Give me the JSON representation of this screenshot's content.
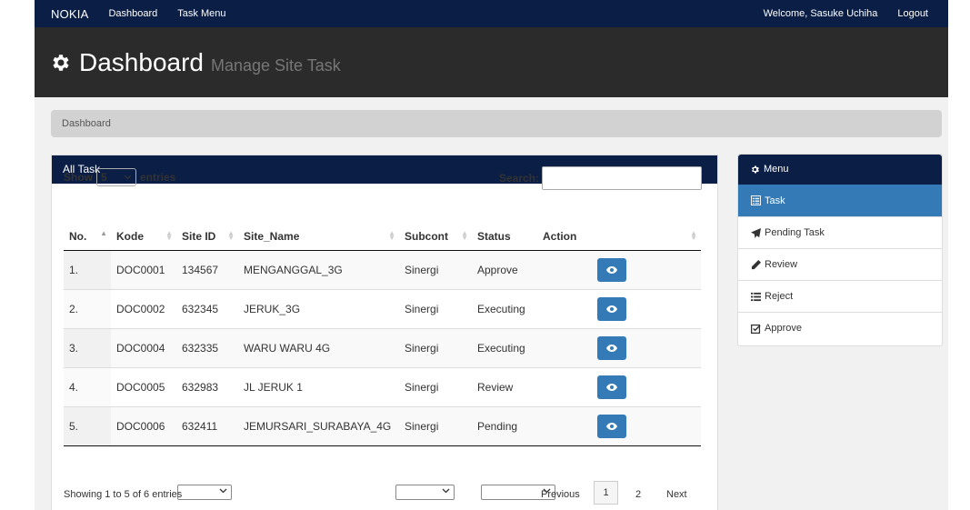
{
  "topbar": {
    "brand": "NOKIA",
    "nav": [
      "Dashboard",
      "Task Menu"
    ],
    "welcome": "Welcome, Sasuke Uchiha",
    "logout": "Logout"
  },
  "header": {
    "title": "Dashboard",
    "subtitle": "Manage Site Task"
  },
  "breadcrumb": "Dashboard",
  "panel": {
    "title": "All Task",
    "show_label": "Show",
    "show_value": "5",
    "entries_label": "entries",
    "search_label": "Search:",
    "search_value": "",
    "columns": [
      "No.",
      "Kode",
      "Site ID",
      "Site_Name",
      "Subcont",
      "Status",
      "Action"
    ],
    "rows": [
      {
        "no": "1.",
        "kode": "DOC0001",
        "site_id": "134567",
        "site_name": "MENGANGGAL_3G",
        "subcont": "Sinergi",
        "status": "Approve"
      },
      {
        "no": "2.",
        "kode": "DOC0002",
        "site_id": "632345",
        "site_name": "JERUK_3G",
        "subcont": "Sinergi",
        "status": "Executing"
      },
      {
        "no": "3.",
        "kode": "DOC0004",
        "site_id": "632335",
        "site_name": "WARU WARU 4G",
        "subcont": "Sinergi",
        "status": "Executing"
      },
      {
        "no": "4.",
        "kode": "DOC0005",
        "site_id": "632983",
        "site_name": "JL JERUK 1",
        "subcont": "Sinergi",
        "status": "Review"
      },
      {
        "no": "5.",
        "kode": "DOC0006",
        "site_id": "632411",
        "site_name": "JEMURSARI_SURABAYA_4G",
        "subcont": "Sinergi",
        "status": "Pending"
      }
    ],
    "info": "Showing 1 to 5 of 6 entries",
    "pagination": {
      "previous": "Previous",
      "pages": [
        "1",
        "2"
      ],
      "next": "Next",
      "current": "1"
    }
  },
  "menu": {
    "title": "Menu",
    "items": [
      {
        "label": "Task",
        "icon": "list-alt-icon",
        "active": true
      },
      {
        "label": "Pending Task",
        "icon": "paper-plane-icon",
        "active": false
      },
      {
        "label": "Review",
        "icon": "pencil-icon",
        "active": false
      },
      {
        "label": "Reject",
        "icon": "list-icon",
        "active": false
      },
      {
        "label": "Approve",
        "icon": "check-square-icon",
        "active": false
      }
    ]
  },
  "colors": {
    "navy": "#0b1e45",
    "dark_header": "#2b2b2b",
    "primary": "#337ab7",
    "content_bg": "#f1f1f1"
  }
}
